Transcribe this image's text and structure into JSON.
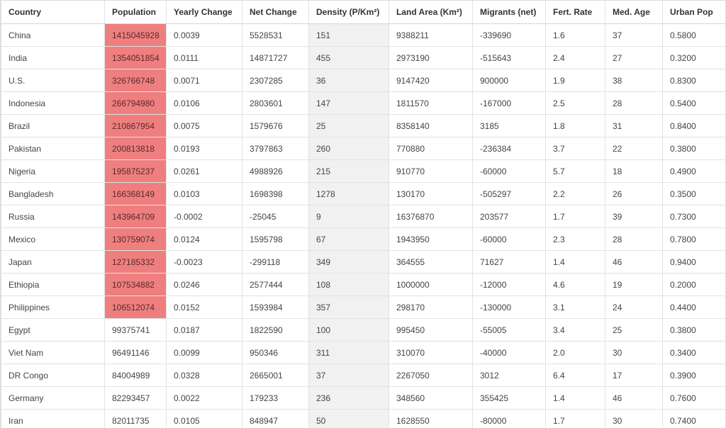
{
  "colors": {
    "population_highlight": "#ef7f7f",
    "density_column_bg": "#f1f1f1",
    "grid_border": "#e2e2e2"
  },
  "highlight_rule": "population > 100000000",
  "table": {
    "columns": [
      {
        "key": "country",
        "label": "Country"
      },
      {
        "key": "population",
        "label": "Population"
      },
      {
        "key": "yearly_change",
        "label": "Yearly Change"
      },
      {
        "key": "net_change",
        "label": "Net Change"
      },
      {
        "key": "density",
        "label": "Density (P/Km²)"
      },
      {
        "key": "land_area",
        "label": "Land Area (Km²)"
      },
      {
        "key": "migrants",
        "label": "Migrants (net)"
      },
      {
        "key": "fert_rate",
        "label": "Fert. Rate"
      },
      {
        "key": "med_age",
        "label": "Med. Age"
      },
      {
        "key": "urban_pop",
        "label": "Urban Pop"
      }
    ],
    "rows": [
      {
        "country": "China",
        "population": "1415045928",
        "yearly_change": "0.0039",
        "net_change": "5528531",
        "density": "151",
        "land_area": "9388211",
        "migrants": "-339690",
        "fert_rate": "1.6",
        "med_age": "37",
        "urban_pop": "0.5800",
        "highlight": true
      },
      {
        "country": "India",
        "population": "1354051854",
        "yearly_change": "0.0111",
        "net_change": "14871727",
        "density": "455",
        "land_area": "2973190",
        "migrants": "-515643",
        "fert_rate": "2.4",
        "med_age": "27",
        "urban_pop": "0.3200",
        "highlight": true
      },
      {
        "country": "U.S.",
        "population": "326766748",
        "yearly_change": "0.0071",
        "net_change": "2307285",
        "density": "36",
        "land_area": "9147420",
        "migrants": "900000",
        "fert_rate": "1.9",
        "med_age": "38",
        "urban_pop": "0.8300",
        "highlight": true
      },
      {
        "country": "Indonesia",
        "population": "266794980",
        "yearly_change": "0.0106",
        "net_change": "2803601",
        "density": "147",
        "land_area": "1811570",
        "migrants": "-167000",
        "fert_rate": "2.5",
        "med_age": "28",
        "urban_pop": "0.5400",
        "highlight": true
      },
      {
        "country": "Brazil",
        "population": "210867954",
        "yearly_change": "0.0075",
        "net_change": "1579676",
        "density": "25",
        "land_area": "8358140",
        "migrants": "3185",
        "fert_rate": "1.8",
        "med_age": "31",
        "urban_pop": "0.8400",
        "highlight": true
      },
      {
        "country": "Pakistan",
        "population": "200813818",
        "yearly_change": "0.0193",
        "net_change": "3797863",
        "density": "260",
        "land_area": "770880",
        "migrants": "-236384",
        "fert_rate": "3.7",
        "med_age": "22",
        "urban_pop": "0.3800",
        "highlight": true
      },
      {
        "country": "Nigeria",
        "population": "195875237",
        "yearly_change": "0.0261",
        "net_change": "4988926",
        "density": "215",
        "land_area": "910770",
        "migrants": "-60000",
        "fert_rate": "5.7",
        "med_age": "18",
        "urban_pop": "0.4900",
        "highlight": true
      },
      {
        "country": "Bangladesh",
        "population": "166368149",
        "yearly_change": "0.0103",
        "net_change": "1698398",
        "density": "1278",
        "land_area": "130170",
        "migrants": "-505297",
        "fert_rate": "2.2",
        "med_age": "26",
        "urban_pop": "0.3500",
        "highlight": true
      },
      {
        "country": "Russia",
        "population": "143964709",
        "yearly_change": "-0.0002",
        "net_change": "-25045",
        "density": "9",
        "land_area": "16376870",
        "migrants": "203577",
        "fert_rate": "1.7",
        "med_age": "39",
        "urban_pop": "0.7300",
        "highlight": true
      },
      {
        "country": "Mexico",
        "population": "130759074",
        "yearly_change": "0.0124",
        "net_change": "1595798",
        "density": "67",
        "land_area": "1943950",
        "migrants": "-60000",
        "fert_rate": "2.3",
        "med_age": "28",
        "urban_pop": "0.7800",
        "highlight": true
      },
      {
        "country": "Japan",
        "population": "127185332",
        "yearly_change": "-0.0023",
        "net_change": "-299118",
        "density": "349",
        "land_area": "364555",
        "migrants": "71627",
        "fert_rate": "1.4",
        "med_age": "46",
        "urban_pop": "0.9400",
        "highlight": true
      },
      {
        "country": "Ethiopia",
        "population": "107534882",
        "yearly_change": "0.0246",
        "net_change": "2577444",
        "density": "108",
        "land_area": "1000000",
        "migrants": "-12000",
        "fert_rate": "4.6",
        "med_age": "19",
        "urban_pop": "0.2000",
        "highlight": true
      },
      {
        "country": "Philippines",
        "population": "106512074",
        "yearly_change": "0.0152",
        "net_change": "1593984",
        "density": "357",
        "land_area": "298170",
        "migrants": "-130000",
        "fert_rate": "3.1",
        "med_age": "24",
        "urban_pop": "0.4400",
        "highlight": true
      },
      {
        "country": "Egypt",
        "population": "99375741",
        "yearly_change": "0.0187",
        "net_change": "1822590",
        "density": "100",
        "land_area": "995450",
        "migrants": "-55005",
        "fert_rate": "3.4",
        "med_age": "25",
        "urban_pop": "0.3800",
        "highlight": false
      },
      {
        "country": "Viet Nam",
        "population": "96491146",
        "yearly_change": "0.0099",
        "net_change": "950346",
        "density": "311",
        "land_area": "310070",
        "migrants": "-40000",
        "fert_rate": "2.0",
        "med_age": "30",
        "urban_pop": "0.3400",
        "highlight": false
      },
      {
        "country": "DR Congo",
        "population": "84004989",
        "yearly_change": "0.0328",
        "net_change": "2665001",
        "density": "37",
        "land_area": "2267050",
        "migrants": "3012",
        "fert_rate": "6.4",
        "med_age": "17",
        "urban_pop": "0.3900",
        "highlight": false
      },
      {
        "country": "Germany",
        "population": "82293457",
        "yearly_change": "0.0022",
        "net_change": "179233",
        "density": "236",
        "land_area": "348560",
        "migrants": "355425",
        "fert_rate": "1.4",
        "med_age": "46",
        "urban_pop": "0.7600",
        "highlight": false
      },
      {
        "country": "Iran",
        "population": "82011735",
        "yearly_change": "0.0105",
        "net_change": "848947",
        "density": "50",
        "land_area": "1628550",
        "migrants": "-80000",
        "fert_rate": "1.7",
        "med_age": "30",
        "urban_pop": "0.7400",
        "highlight": false
      }
    ]
  }
}
